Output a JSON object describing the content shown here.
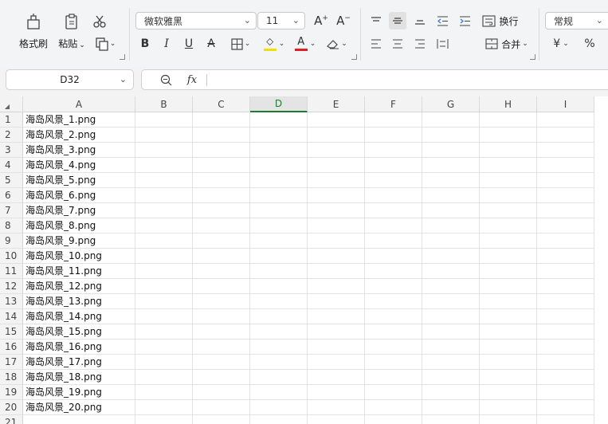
{
  "ribbon": {
    "clipboard": {
      "format_painter": "格式刷",
      "paste": "粘贴"
    },
    "font": {
      "name": "微软雅黑",
      "size": "11"
    },
    "alignment": {
      "wrap": "换行",
      "merge": "合并"
    },
    "number": {
      "format": "常规",
      "currency_symbol": "¥",
      "percent_symbol": "%"
    },
    "font_color_accent": "#e02020",
    "fill_color_accent": "#f0e000"
  },
  "formula_bar": {
    "name_box": "D32",
    "fx_label": "fx",
    "formula": ""
  },
  "sheet": {
    "select_all": "◢",
    "selected_column": "D",
    "columns": [
      "A",
      "B",
      "C",
      "D",
      "E",
      "F",
      "G",
      "H",
      "I"
    ],
    "rows": [
      "1",
      "2",
      "3",
      "4",
      "5",
      "6",
      "7",
      "8",
      "9",
      "10",
      "11",
      "12",
      "13",
      "14",
      "15",
      "16",
      "17",
      "18",
      "19",
      "20",
      "21"
    ],
    "cells_A": [
      "海岛风景_1.png",
      "海岛风景_2.png",
      "海岛风景_3.png",
      "海岛风景_4.png",
      "海岛风景_5.png",
      "海岛风景_6.png",
      "海岛风景_7.png",
      "海岛风景_8.png",
      "海岛风景_9.png",
      "海岛风景_10.png",
      "海岛风景_11.png",
      "海岛风景_12.png",
      "海岛风景_13.png",
      "海岛风景_14.png",
      "海岛风景_15.png",
      "海岛风景_16.png",
      "海岛风景_17.png",
      "海岛风景_18.png",
      "海岛风景_19.png",
      "海岛风景_20.png",
      ""
    ]
  }
}
